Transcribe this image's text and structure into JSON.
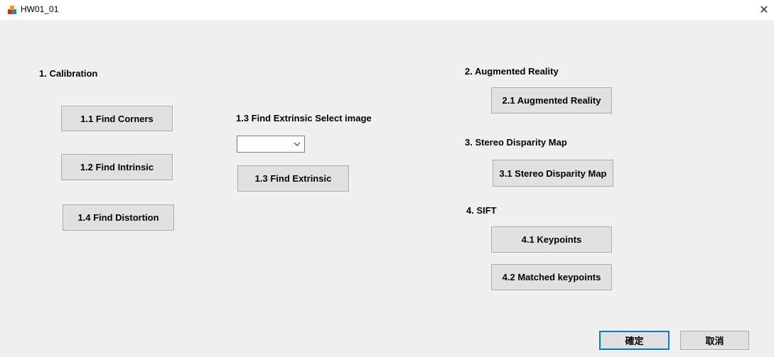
{
  "window": {
    "title": "HW01_01",
    "close_glyph": "✕"
  },
  "section1": {
    "heading": "1. Calibration",
    "find_corners": "1.1 Find Corners",
    "find_intrinsic": "1.2 Find Intrinsic",
    "find_distortion": "1.4 Find Distortion",
    "extrinsic_label": "1.3 Find Extrinsic Select image",
    "extrinsic_select_value": "",
    "find_extrinsic": "1.3 Find Extrinsic"
  },
  "section2": {
    "heading": "2. Augmented Reality",
    "button": "2.1 Augmented Reality"
  },
  "section3": {
    "heading": "3. Stereo Disparity Map",
    "button": "3.1 Stereo Disparity Map"
  },
  "section4": {
    "heading": "4. SIFT",
    "keypoints": "4.1 Keypoints",
    "matched": "4.2 Matched keypoints"
  },
  "dialog": {
    "ok": "確定",
    "cancel": "取消"
  },
  "icons": {
    "app": "app-icon",
    "close": "close-icon",
    "dropdown": "chevron-down-icon"
  }
}
